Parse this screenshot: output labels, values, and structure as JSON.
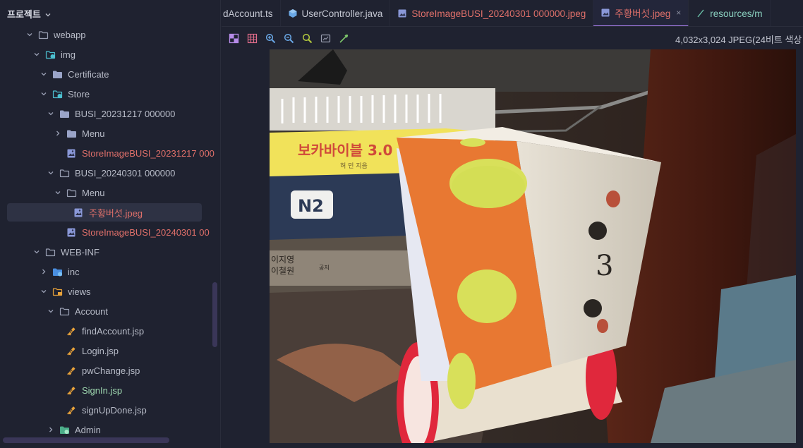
{
  "project_panel": {
    "title": "프로젝트",
    "tree": [
      {
        "label": "webapp",
        "depth": 0,
        "icon": "folder",
        "expanded": true,
        "style": "normal"
      },
      {
        "label": "img",
        "depth": 1,
        "icon": "web-folder",
        "expanded": true,
        "style": "normal"
      },
      {
        "label": "Certificate",
        "depth": 2,
        "icon": "folder-solid",
        "expanded": true,
        "style": "normal"
      },
      {
        "label": "Store",
        "depth": 2,
        "icon": "web-folder",
        "expanded": true,
        "style": "normal"
      },
      {
        "label": "BUSI_20231217 000000",
        "depth": 3,
        "icon": "folder-solid",
        "expanded": true,
        "style": "normal"
      },
      {
        "label": "Menu",
        "depth": 4,
        "icon": "folder-solid",
        "expanded": false,
        "style": "normal"
      },
      {
        "label": "StoreImageBUSI_20231217 000",
        "depth": 4,
        "icon": "image-file",
        "expanded": null,
        "style": "red"
      },
      {
        "label": "BUSI_20240301 000000",
        "depth": 3,
        "icon": "folder",
        "expanded": true,
        "style": "normal"
      },
      {
        "label": "Menu",
        "depth": 4,
        "icon": "folder",
        "expanded": true,
        "style": "normal"
      },
      {
        "label": "주황버섯.jpeg",
        "depth": 5,
        "icon": "image-file",
        "expanded": null,
        "style": "red",
        "selected": true
      },
      {
        "label": "StoreImageBUSI_20240301 00",
        "depth": 4,
        "icon": "image-file",
        "expanded": null,
        "style": "red"
      },
      {
        "label": "WEB-INF",
        "depth": 1,
        "icon": "folder",
        "expanded": true,
        "style": "normal"
      },
      {
        "label": "inc",
        "depth": 2,
        "icon": "folder-blue",
        "expanded": false,
        "style": "normal"
      },
      {
        "label": "views",
        "depth": 2,
        "icon": "folder-orange",
        "expanded": true,
        "style": "normal"
      },
      {
        "label": "Account",
        "depth": 3,
        "icon": "folder",
        "expanded": true,
        "style": "normal"
      },
      {
        "label": "findAccount.jsp",
        "depth": 4,
        "icon": "jsp-file",
        "expanded": null,
        "style": "normal"
      },
      {
        "label": "Login.jsp",
        "depth": 4,
        "icon": "jsp-file",
        "expanded": null,
        "style": "normal"
      },
      {
        "label": "pwChange.jsp",
        "depth": 4,
        "icon": "jsp-file",
        "expanded": null,
        "style": "normal"
      },
      {
        "label": "SignIn.jsp",
        "depth": 4,
        "icon": "jsp-file",
        "expanded": null,
        "style": "green"
      },
      {
        "label": "signUpDone.jsp",
        "depth": 4,
        "icon": "jsp-file",
        "expanded": null,
        "style": "normal"
      },
      {
        "label": "Admin",
        "depth": 3,
        "icon": "web-folder-green",
        "expanded": false,
        "style": "normal"
      }
    ]
  },
  "tabs": [
    {
      "label": "dAccount.ts",
      "icon": "none",
      "style": "normal",
      "active": false
    },
    {
      "label": "UserController.java",
      "icon": "java-class-icon",
      "style": "normal",
      "active": false
    },
    {
      "label": "StoreImageBUSI_20240301 000000.jpeg",
      "icon": "image-file-icon",
      "style": "red",
      "active": false
    },
    {
      "label": "주황버섯.jpeg",
      "icon": "image-file-icon",
      "style": "red",
      "active": true,
      "close": "×"
    },
    {
      "label": "resources/m",
      "icon": "path-icon",
      "style": "green",
      "active": false
    }
  ],
  "image_toolbar": {
    "buttons": [
      "chessboard-icon",
      "grid-icon",
      "zoom-in-icon",
      "zoom-out-icon",
      "actual-size-icon",
      "fit-window-icon",
      "color-picker-icon"
    ],
    "info": "4,032x3,024 JPEG(24비트 색상"
  },
  "image": {
    "book_title": "보카바이블 3.0",
    "book_author": "허 민 지음",
    "book_badge": "N2",
    "book2_line1": "이지영",
    "book2_line2": "이철원",
    "book2_suffix": "공저",
    "box_number": "3"
  },
  "colors": {
    "accent": "#a67de8",
    "modified_red": "#e0706a",
    "added_green": "#9fd8b0"
  }
}
